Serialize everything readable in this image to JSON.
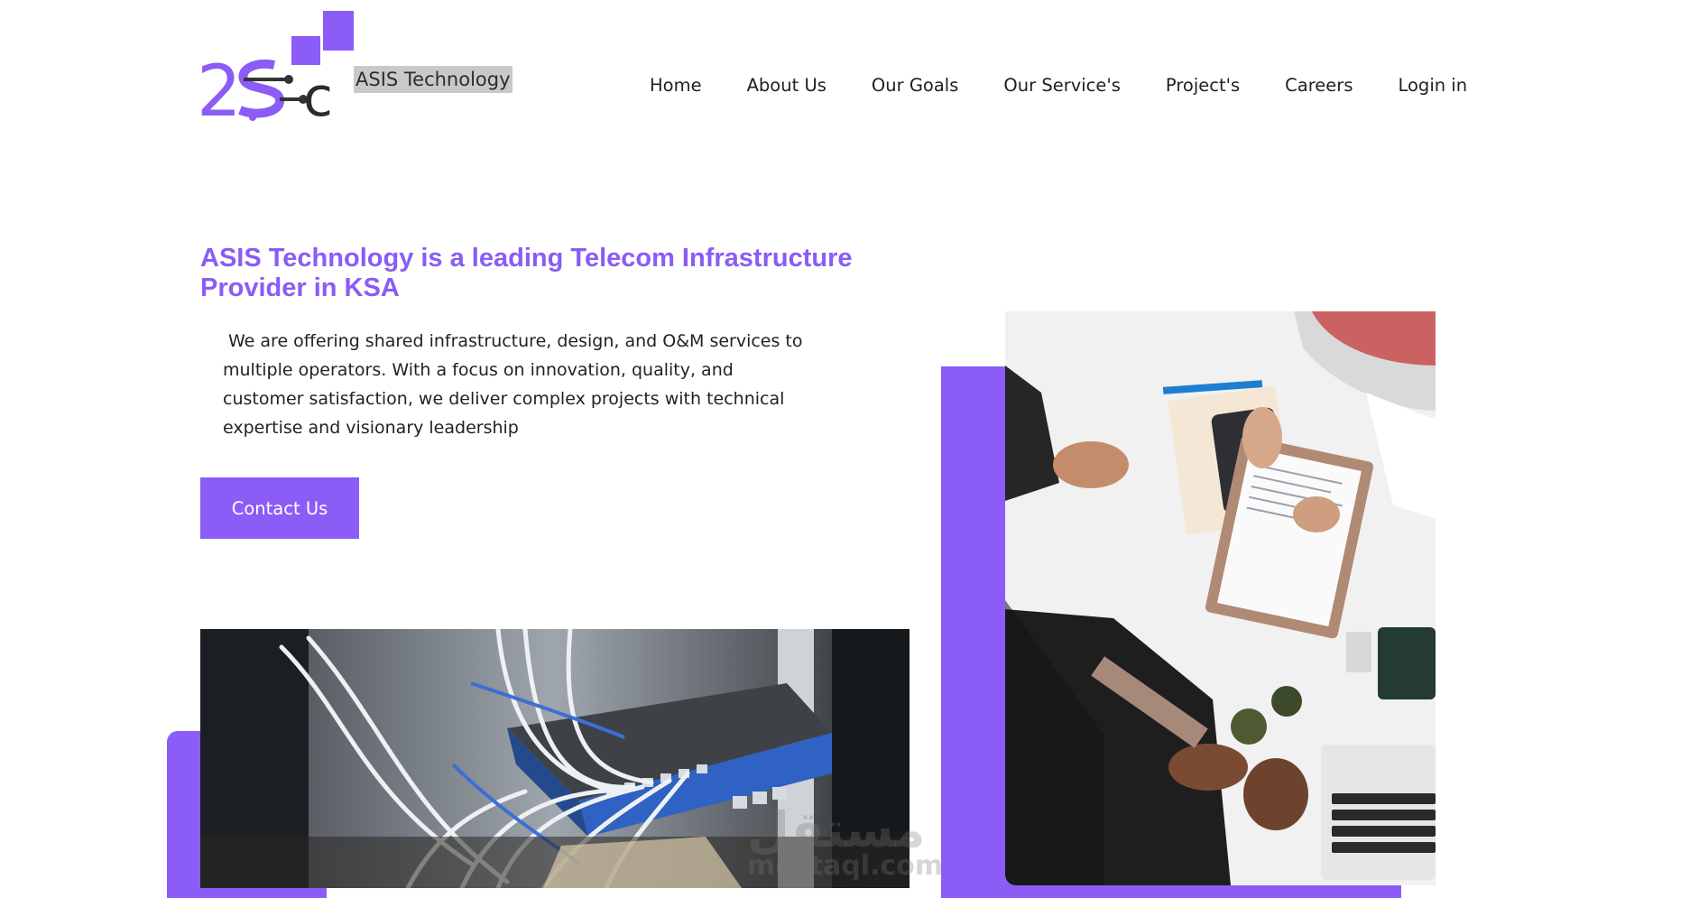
{
  "header": {
    "logo_text": "2SC",
    "brand_name": "ASIS Technology",
    "nav": [
      "Home",
      "About Us",
      "Our Goals",
      "Our Service's",
      "Project's",
      "Careers",
      "Login in"
    ]
  },
  "hero": {
    "title": "ASIS Technology is a leading Telecom Infrastructure Provider in KSA",
    "description": "We are offering shared infrastructure, design, and O&M services to multiple operators. With a focus on innovation, quality, and customer satisfaction, we deliver complex projects with technical expertise and visionary leadership",
    "contact_button": "Contact Us"
  },
  "watermark": {
    "arabic": "مستقل",
    "latin": "mostaql.com"
  },
  "colors": {
    "accent": "#8b5cf6",
    "title": "#8a5cf5",
    "text": "#222222"
  }
}
